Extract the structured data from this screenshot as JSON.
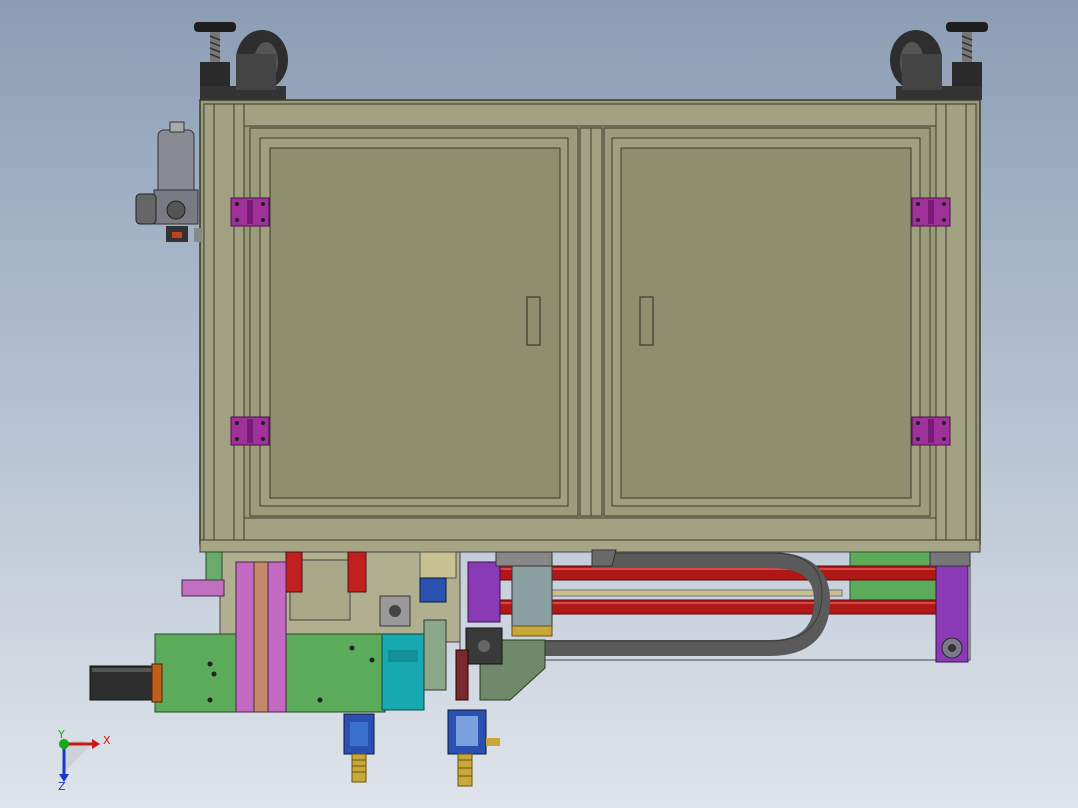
{
  "triad": {
    "x_label": "X",
    "y_label": "Y",
    "z_label": "Z"
  },
  "colors": {
    "background_top": "#8b9db5",
    "background_bottom": "#dfe4ea",
    "cabinet": "#9a9a78",
    "cabinet_panel": "#8f8f70",
    "frame_edge": "#3a3a30",
    "hinge": "#a0309a",
    "red_rod": "#b01818",
    "green_plate": "#5cab5a",
    "cyan_block": "#17a8b0",
    "purple_block": "#8a3ab4",
    "cable_chain": "#5a5a5a",
    "motor": "#2e2e2e",
    "brass": "#c8a838"
  }
}
